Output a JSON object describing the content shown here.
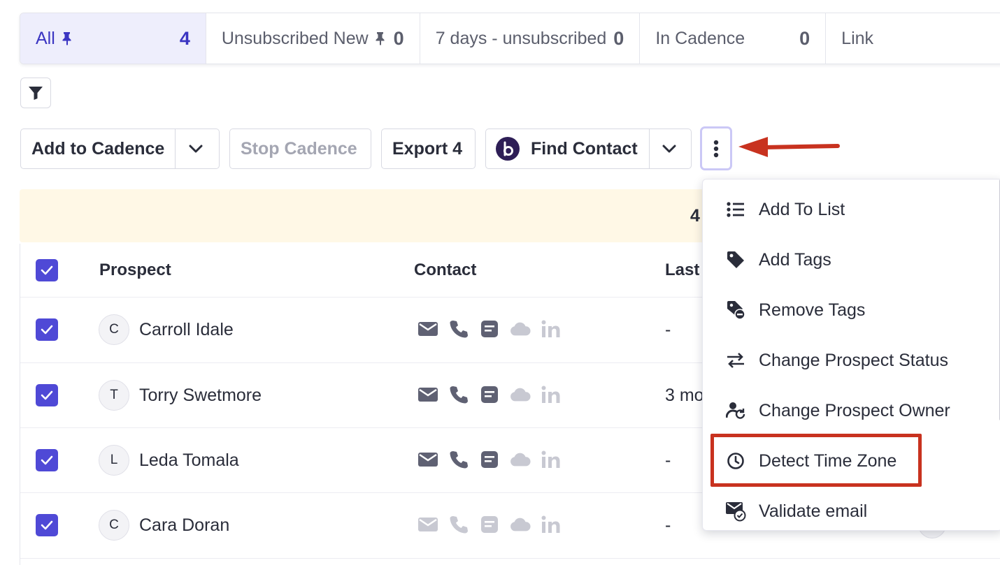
{
  "tabs": [
    {
      "name": "All",
      "count": "4",
      "pinned": true,
      "active": true
    },
    {
      "name": "Unsubscribed New",
      "count": "0",
      "pinned": true,
      "active": false
    },
    {
      "name": "7 days - unsubscribed",
      "count": "0",
      "pinned": false,
      "active": false
    },
    {
      "name": "In Cadence",
      "count": "0",
      "pinned": false,
      "active": false
    },
    {
      "name": "Link",
      "count": "",
      "pinned": false,
      "active": false
    }
  ],
  "toolbar": {
    "add_to_cadence": "Add to Cadence",
    "stop_cadence": "Stop Cadence",
    "export": "Export 4",
    "find_contact": "Find Contact",
    "find_logo_letter": "b"
  },
  "banner": {
    "text": "4"
  },
  "table": {
    "headers": {
      "prospect": "Prospect",
      "contact": "Contact",
      "last": "Last"
    },
    "rows": [
      {
        "initial": "C",
        "name": "Carroll Idale",
        "last": "-",
        "contact_muted": false
      },
      {
        "initial": "T",
        "name": "Torry Swetmore",
        "last": "3 mo",
        "contact_muted": false
      },
      {
        "initial": "L",
        "name": "Leda Tomala",
        "last": "-",
        "contact_muted": false
      },
      {
        "initial": "C",
        "name": "Cara Doran",
        "last": "-",
        "contact_muted": true
      }
    ],
    "contact_icons": [
      "email-icon",
      "phone-icon",
      "note-icon",
      "cloud-icon",
      "linkedin-icon"
    ]
  },
  "menu": {
    "items": [
      {
        "label": "Add To List",
        "icon": "list-icon"
      },
      {
        "label": "Add Tags",
        "icon": "tag-icon"
      },
      {
        "label": "Remove Tags",
        "icon": "tag-remove-icon"
      },
      {
        "label": "Change Prospect Status",
        "icon": "swap-arrows-icon"
      },
      {
        "label": "Change Prospect Owner",
        "icon": "user-refresh-icon"
      },
      {
        "label": "Detect Time Zone",
        "icon": "clock-icon"
      },
      {
        "label": "Validate email",
        "icon": "mail-check-icon"
      }
    ]
  },
  "colors": {
    "accent": "#4f49d6",
    "active_tab_bg": "#eeeefc",
    "banner_bg": "#fff8e6",
    "annotation_red": "#c8321f"
  }
}
